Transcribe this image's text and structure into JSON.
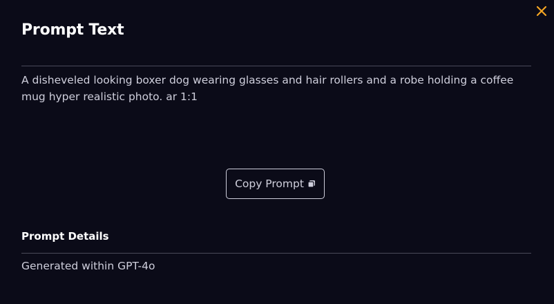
{
  "modal": {
    "title": "Prompt Text",
    "prompt_text": "A disheveled looking boxer dog wearing glasses and hair rollers and a robe holding a coffee mug hyper realistic photo. ar 1:1",
    "copy_button_label": "Copy Prompt",
    "copy_icon": "copy-icon",
    "close_icon": "close-icon",
    "details_heading": "Prompt Details",
    "details_text": "Generated within GPT-4o"
  },
  "colors": {
    "background": "#0b0b18",
    "title": "#ffffff",
    "body_text": "#cfcfdc",
    "divider": "#4a4a5a",
    "close_icon": "#f5a623"
  }
}
